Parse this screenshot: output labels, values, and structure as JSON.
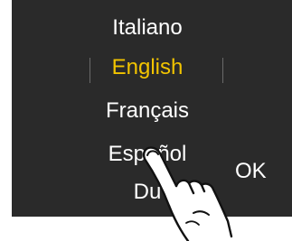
{
  "languages": [
    {
      "label": "Italiano",
      "selected": false
    },
    {
      "label": "English",
      "selected": true
    },
    {
      "label": "Français",
      "selected": false
    },
    {
      "label": "Español",
      "selected": false
    },
    {
      "label": "Du",
      "selected": false
    }
  ],
  "ok_label": "OK",
  "colors": {
    "screen_background": "#2a2a2a",
    "text": "#ffffff",
    "selected_text": "#f2c400",
    "selection_bar": "#6a6a6a"
  },
  "icons": {
    "hand": "pointing-hand-icon"
  }
}
